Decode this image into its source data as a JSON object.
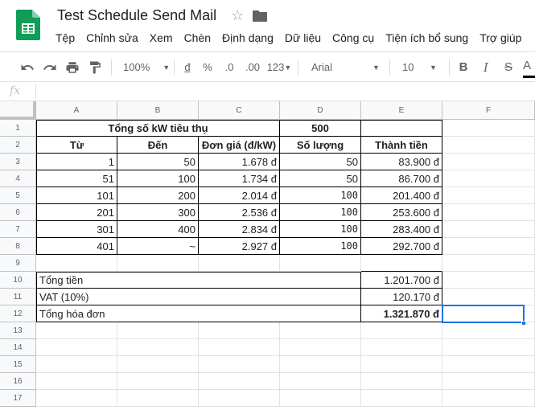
{
  "doc": {
    "title": "Test Schedule Send Mail"
  },
  "menu": [
    "Tệp",
    "Chỉnh sửa",
    "Xem",
    "Chèn",
    "Định dạng",
    "Dữ liệu",
    "Công cụ",
    "Tiện ích bổ sung",
    "Trợ giúp"
  ],
  "toolbar": {
    "zoom": "100%",
    "currency": "đ",
    "percent": "%",
    "dec_decrease": ".0",
    "dec_increase": ".00",
    "more_formats": "123",
    "font": "Arial",
    "font_size": "10",
    "bold": "B",
    "italic": "I",
    "strike": "S",
    "text_color": "A"
  },
  "formula_bar": {
    "fx": "fx",
    "content": ""
  },
  "columns": [
    "A",
    "B",
    "C",
    "D",
    "E",
    "F"
  ],
  "rows": [
    "1",
    "2",
    "3",
    "4",
    "5",
    "6",
    "7",
    "8",
    "9",
    "10",
    "11",
    "12",
    "13",
    "14",
    "15",
    "16",
    "17"
  ],
  "sheet": {
    "r1": {
      "total_kw_label": "Tổng số kW tiêu thụ",
      "total_kw_value": "500"
    },
    "header": {
      "from": "Từ",
      "to": "Đến",
      "price": "Đơn giá (đ/kW)",
      "qty": "Số lượng",
      "amount": "Thành tiền"
    },
    "tiers": [
      {
        "from": "1",
        "to": "50",
        "price": "1.678 đ",
        "qty": "50",
        "amount": "83.900 đ"
      },
      {
        "from": "51",
        "to": "100",
        "price": "1.734 đ",
        "qty": "50",
        "amount": "86.700 đ"
      },
      {
        "from": "101",
        "to": "200",
        "price": "2.014 đ",
        "qty": "100",
        "amount": "201.400 đ"
      },
      {
        "from": "201",
        "to": "300",
        "price": "2.536 đ",
        "qty": "100",
        "amount": "253.600 đ"
      },
      {
        "from": "301",
        "to": "400",
        "price": "2.834 đ",
        "qty": "100",
        "amount": "283.400 đ"
      },
      {
        "from": "401",
        "to": "~",
        "price": "2.927 đ",
        "qty": "100",
        "amount": "292.700 đ"
      }
    ],
    "totals": [
      {
        "label": "Tổng tiền",
        "value": "1.201.700 đ"
      },
      {
        "label": "VAT (10%)",
        "value": "120.170 đ"
      },
      {
        "label": "Tổng hóa đơn",
        "value": "1.321.870 đ"
      }
    ]
  },
  "colors": {
    "accent": "#1a73e8",
    "sheets_green": "#0f9d58"
  }
}
